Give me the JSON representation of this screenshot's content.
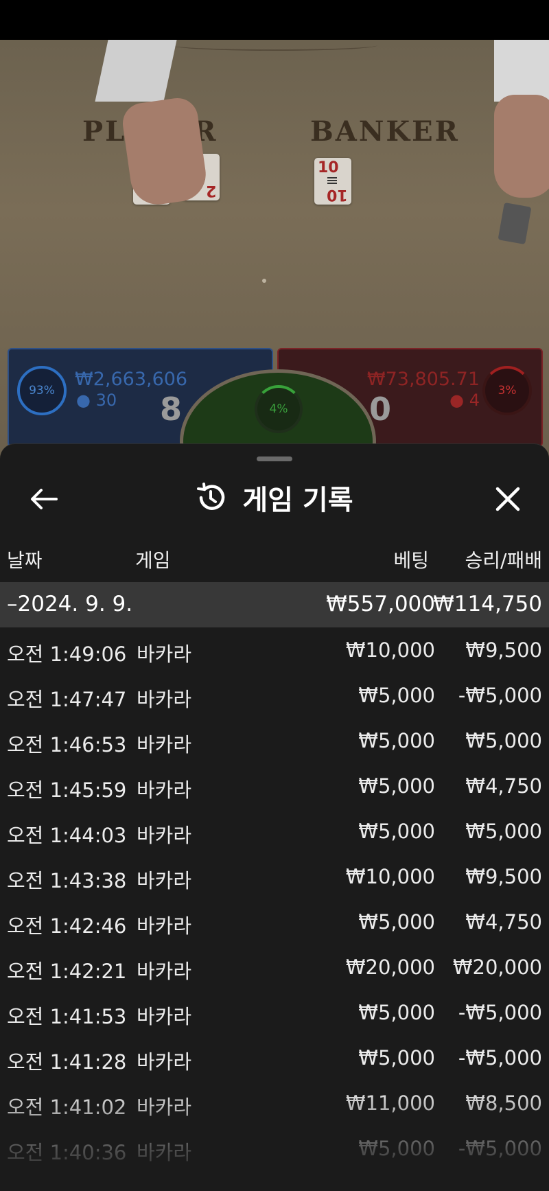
{
  "game_view": {
    "player_label": "PLAYER",
    "banker_label": "BANKER",
    "player_cards": [
      {
        "rank": "8",
        "suit": "♦"
      },
      {
        "rank": "2",
        "suit": "♥"
      }
    ],
    "banker_cards": [
      {
        "rank": "10",
        "suit": "♥"
      }
    ]
  },
  "bet_panels": {
    "player": {
      "percent": "93%",
      "amount": "₩2,663,606",
      "players": "30",
      "score": "8",
      "color": "#2d6fc2"
    },
    "tie": {
      "percent": "4%",
      "color": "#38a13a"
    },
    "banker": {
      "percent": "3%",
      "amount": "₩73,805.71",
      "players": "4",
      "score": "0",
      "color": "#c53131"
    }
  },
  "history_sheet": {
    "title": "게임 기록",
    "back_icon": "arrow-left-icon",
    "history_icon": "history-clock-icon",
    "close_icon": "close-icon",
    "columns": {
      "date": "날짜",
      "game": "게임",
      "bet": "베팅",
      "win_loss": "승리/패배"
    },
    "date_group": {
      "date": "–2024. 9. 9.",
      "bet_total": "₩557,000",
      "win_total": "₩114,750"
    },
    "rows": [
      {
        "time": "오전 1:49:06",
        "game": "바카라",
        "bet": "₩10,000",
        "result": "₩9,500"
      },
      {
        "time": "오전 1:47:47",
        "game": "바카라",
        "bet": "₩5,000",
        "result": "-₩5,000"
      },
      {
        "time": "오전 1:46:53",
        "game": "바카라",
        "bet": "₩5,000",
        "result": "₩5,000"
      },
      {
        "time": "오전 1:45:59",
        "game": "바카라",
        "bet": "₩5,000",
        "result": "₩4,750"
      },
      {
        "time": "오전 1:44:03",
        "game": "바카라",
        "bet": "₩5,000",
        "result": "₩5,000"
      },
      {
        "time": "오전 1:43:38",
        "game": "바카라",
        "bet": "₩10,000",
        "result": "₩9,500"
      },
      {
        "time": "오전 1:42:46",
        "game": "바카라",
        "bet": "₩5,000",
        "result": "₩4,750"
      },
      {
        "time": "오전 1:42:21",
        "game": "바카라",
        "bet": "₩20,000",
        "result": "₩20,000"
      },
      {
        "time": "오전 1:41:53",
        "game": "바카라",
        "bet": "₩5,000",
        "result": "-₩5,000"
      },
      {
        "time": "오전 1:41:28",
        "game": "바카라",
        "bet": "₩5,000",
        "result": "-₩5,000"
      },
      {
        "time": "오전 1:41:02",
        "game": "바카라",
        "bet": "₩11,000",
        "result": "₩8,500"
      },
      {
        "time": "오전 1:40:36",
        "game": "바카라",
        "bet": "₩5,000",
        "result": "-₩5,000"
      }
    ]
  }
}
